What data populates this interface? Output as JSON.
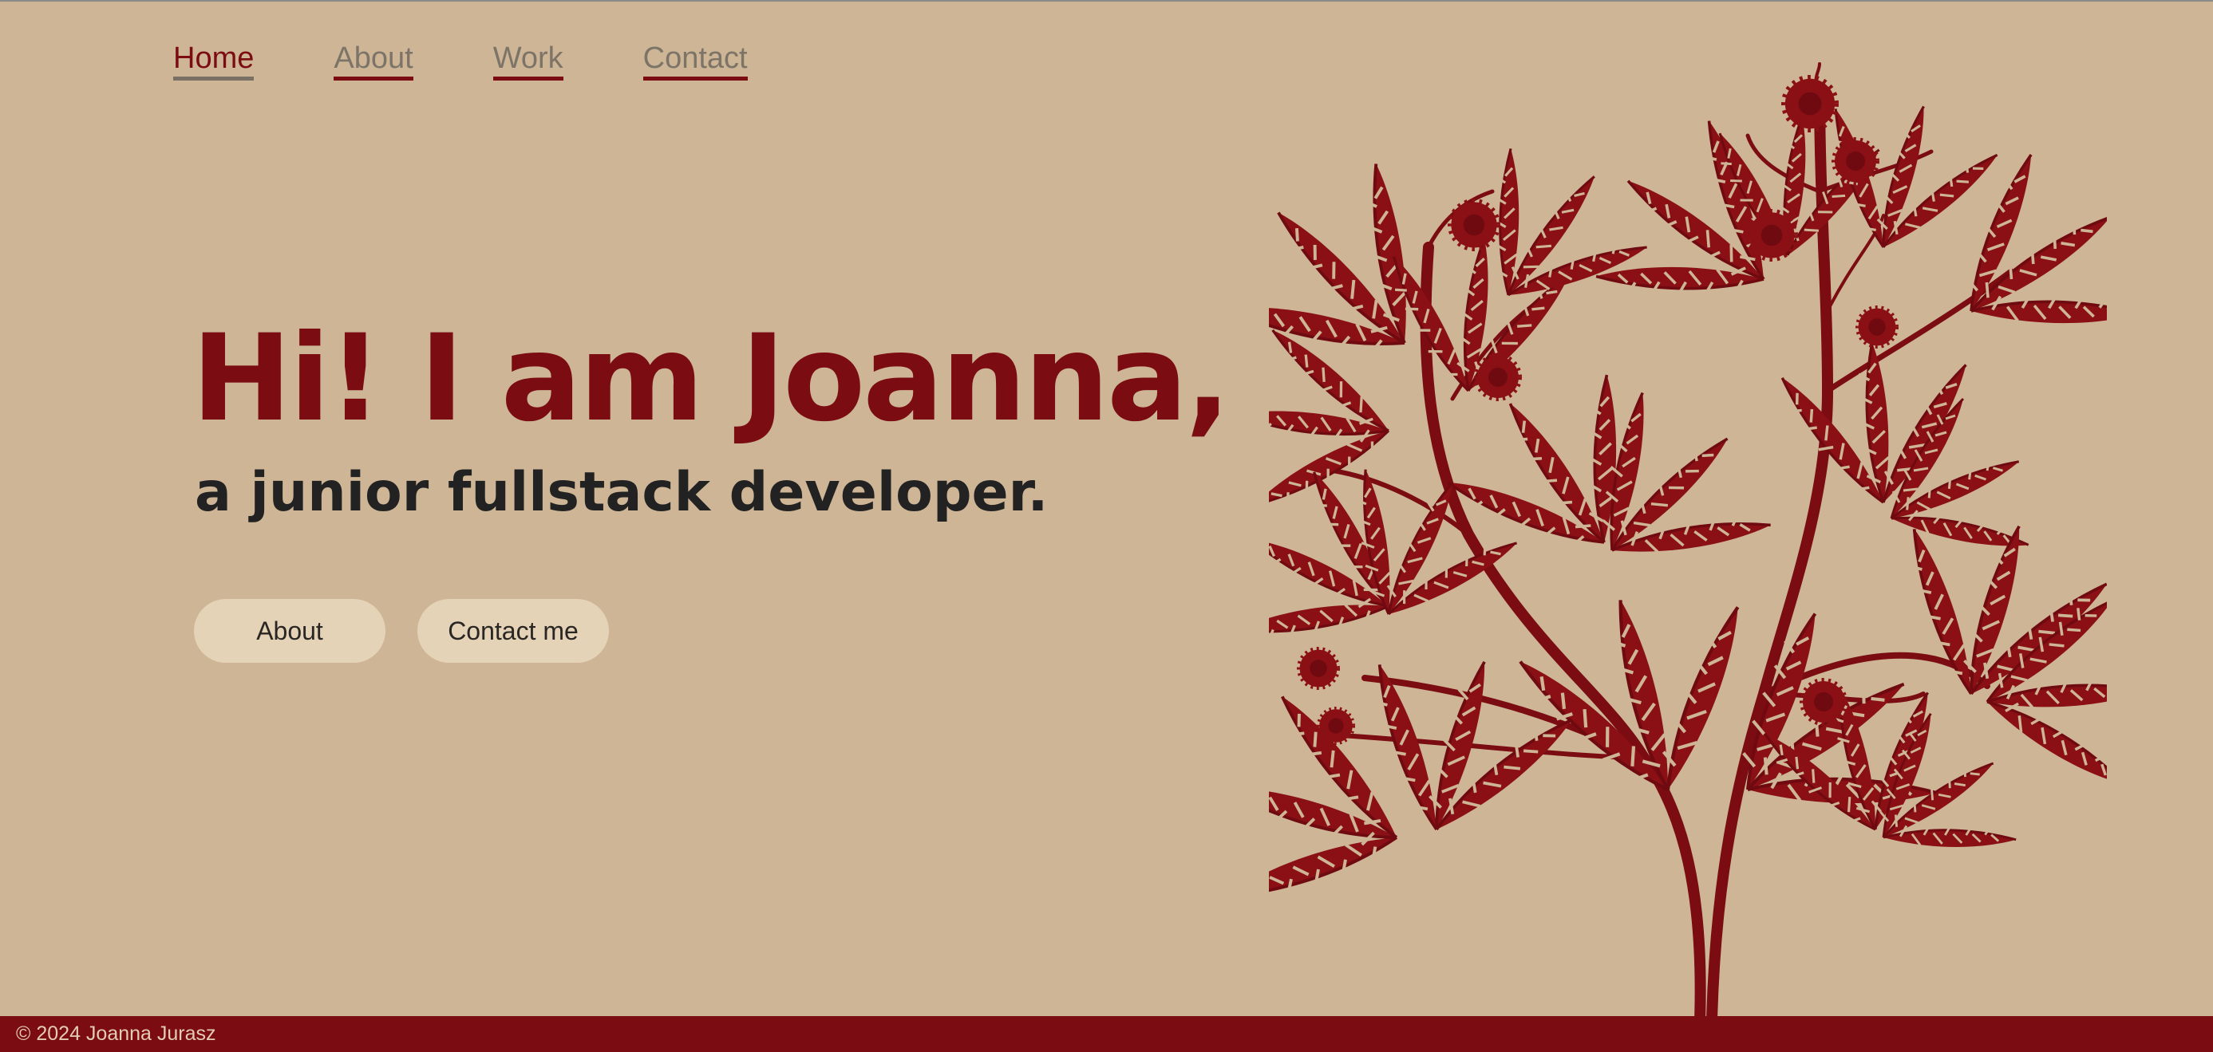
{
  "nav": {
    "items": [
      {
        "label": "Home",
        "active": true
      },
      {
        "label": "About",
        "active": false
      },
      {
        "label": "Work",
        "active": false
      },
      {
        "label": "Contact",
        "active": false
      }
    ]
  },
  "hero": {
    "title": "Hi! I am Joanna,",
    "subtitle": "a junior fullstack developer."
  },
  "buttons": {
    "about_label": "About",
    "contact_label": "Contact me"
  },
  "illustration": {
    "icon": "botanical-plant-illustration"
  },
  "footer": {
    "copyright": "© 2024 Joanna Jurasz"
  },
  "colors": {
    "background": "#ceb596",
    "accent": "#7a0c12",
    "text_dark": "#222222",
    "nav_inactive": "#7d7468",
    "pill_bg": "#e5d3b8",
    "footer_text": "#e3cdb0"
  }
}
